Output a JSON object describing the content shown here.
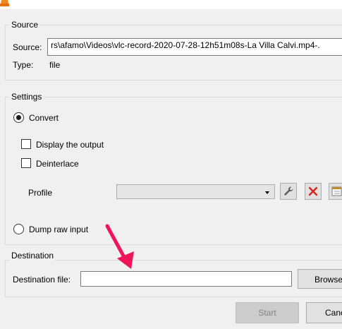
{
  "source": {
    "legend": "Source",
    "source_label": "Source:",
    "source_value": "rs\\afamo\\Videos\\vlc-record-2020-07-28-12h51m08s-La Villa Calvi.mp4-.",
    "type_label": "Type:",
    "type_value": "file"
  },
  "settings": {
    "legend": "Settings",
    "convert_label": "Convert",
    "convert_selected": true,
    "display_output_label": "Display the output",
    "deinterlace_label": "Deinterlace",
    "profile_label": "Profile",
    "profile_value": "",
    "dump_raw_label": "Dump raw input"
  },
  "destination": {
    "legend": "Destination",
    "file_label": "Destination file:",
    "file_value": "",
    "browse_label": "Browse"
  },
  "footer": {
    "start_label": "Start",
    "cancel_label": "Cancel"
  },
  "colors": {
    "annotation_arrow": "#f0145a",
    "delete_icon": "#d7261e"
  }
}
